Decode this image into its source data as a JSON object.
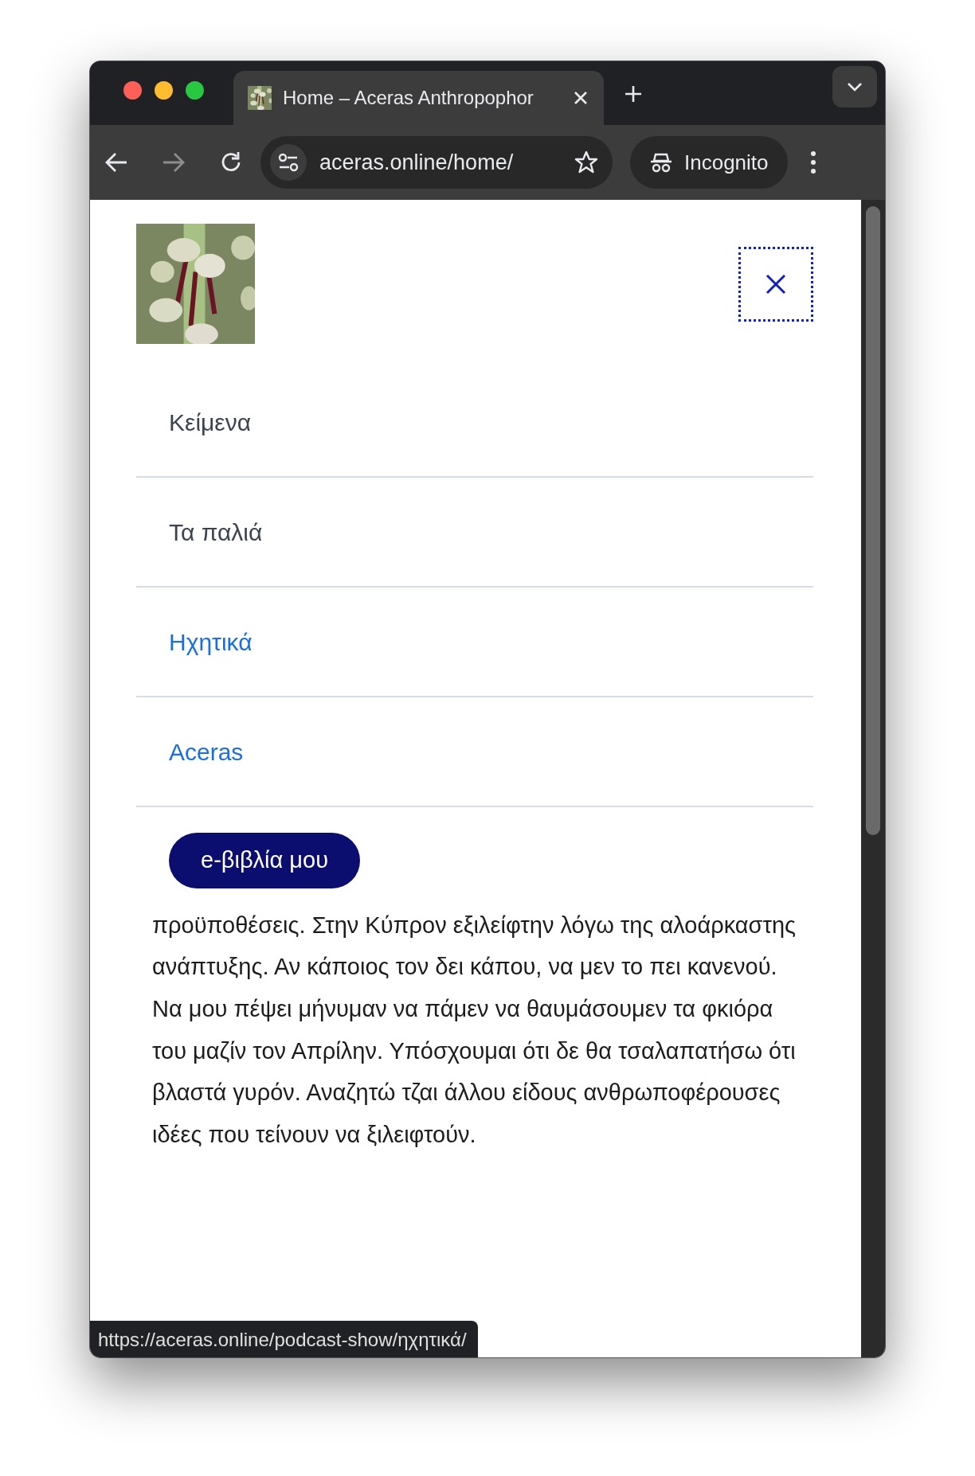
{
  "tab": {
    "title": "Home – Aceras Anthropophor"
  },
  "toolbar": {
    "url": "aceras.online/home/",
    "profile": "Incognito"
  },
  "page": {
    "menu": [
      {
        "label": "Κείμενα",
        "color": "#3c4452"
      },
      {
        "label": "Τα παλιά",
        "color": "#3c4452"
      },
      {
        "label": "Ηχητικά",
        "color": "#1a6fe0"
      },
      {
        "label": "Aceras",
        "color": "#1a6fe0"
      }
    ],
    "button": "e-βιβλία μου",
    "paragraph": "προϋποθέσεις. Στην Κύπρον εξιλείφτην λόγω της αλοάρκαστης ανάπτυξης. Αν κάποιος τον δει κάπου, να μεν το πει κανενού. Να μου πέψει μήνυμαν να πάμεν να θαυμάσουμεν τα φκιόρα του μαζίν τον Απρίλην. Υπόσχουμαι ότι δε θα τσαλαπατήσω ότι βλαστά γυρόν. Αναζητώ τζαι άλλου είδους ανθρωποφέρουσες ιδέες που τείνουν να ξιλειφτούν."
  },
  "status_bar": "https://aceras.online/podcast-show/ηχητικά/"
}
